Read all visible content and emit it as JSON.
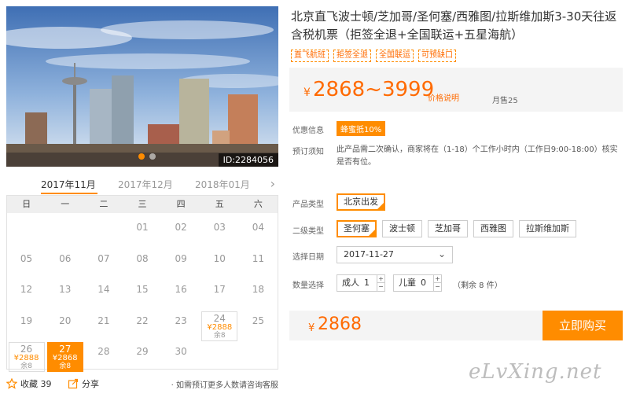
{
  "product": {
    "photo_id": "ID:2284056",
    "title": "北京直飞波士顿/芝加哥/圣何塞/西雅图/拉斯维加斯3-30天往返含税机票（拒签全退+全国联运+五星海航）",
    "tags": [
      "直飞航班",
      "拒签全退",
      "全国联运",
      "可预缺口"
    ],
    "currency": "¥",
    "price_range": "2868~3999",
    "price_note": "价格说明",
    "monthly_sales": "月售25"
  },
  "calendar": {
    "months": [
      "2017年11月",
      "2017年12月",
      "2018年01月"
    ],
    "weekdays": [
      "日",
      "一",
      "二",
      "三",
      "四",
      "五",
      "六"
    ],
    "rows": [
      [
        {
          "d": ""
        },
        {
          "d": ""
        },
        {
          "d": ""
        },
        {
          "d": "01"
        },
        {
          "d": "02"
        },
        {
          "d": "03"
        },
        {
          "d": "04"
        }
      ],
      [
        {
          "d": "05"
        },
        {
          "d": "06"
        },
        {
          "d": "07"
        },
        {
          "d": "08"
        },
        {
          "d": "09"
        },
        {
          "d": "10"
        },
        {
          "d": "11"
        }
      ],
      [
        {
          "d": "12"
        },
        {
          "d": "13"
        },
        {
          "d": "14"
        },
        {
          "d": "15"
        },
        {
          "d": "16"
        },
        {
          "d": "17"
        },
        {
          "d": "18"
        }
      ],
      [
        {
          "d": "19"
        },
        {
          "d": "20"
        },
        {
          "d": "21"
        },
        {
          "d": "22"
        },
        {
          "d": "23"
        },
        {
          "d": "24",
          "p": "¥2888",
          "r": "余8"
        },
        {
          "d": "25"
        }
      ],
      [
        {
          "d": "26",
          "p": "¥2888",
          "r": "余8"
        },
        {
          "d": "27",
          "p": "¥2868",
          "r": "余8",
          "selected": true
        },
        {
          "d": "28"
        },
        {
          "d": "29"
        },
        {
          "d": "30"
        },
        {
          "d": ""
        },
        {
          "d": ""
        }
      ]
    ]
  },
  "bottom": {
    "favorite_label": "收藏 39",
    "share_label": "分享",
    "note": "· 如需预订更多人数请咨询客服"
  },
  "details": {
    "promo_label": "优惠信息",
    "promo_badge": "蜂蜜抵10%",
    "notice_label": "预订须知",
    "notice_text": "此产品需二次确认，商家将在（1-18）个工作小时内（工作日9:00-18:00）核实是否有位。",
    "type_label": "产品类型",
    "type_options": [
      "北京出发"
    ],
    "subtype_label": "二级类型",
    "subtype_options": [
      "圣何塞",
      "波士顿",
      "芝加哥",
      "西雅图",
      "拉斯维加斯"
    ],
    "date_label": "选择日期",
    "date_value": "2017-11-27",
    "qty_label": "数量选择",
    "adult_label": "成人",
    "adult_value": "1",
    "child_label": "儿童",
    "child_value": "0",
    "stock_text": "（剩余 8 件）"
  },
  "checkout": {
    "currency": "¥",
    "total": "2868",
    "buy_label": "立即购买"
  },
  "watermark": "eLvXing.net",
  "colors": {
    "accent": "#ff8c00",
    "price": "#ff6a00"
  }
}
